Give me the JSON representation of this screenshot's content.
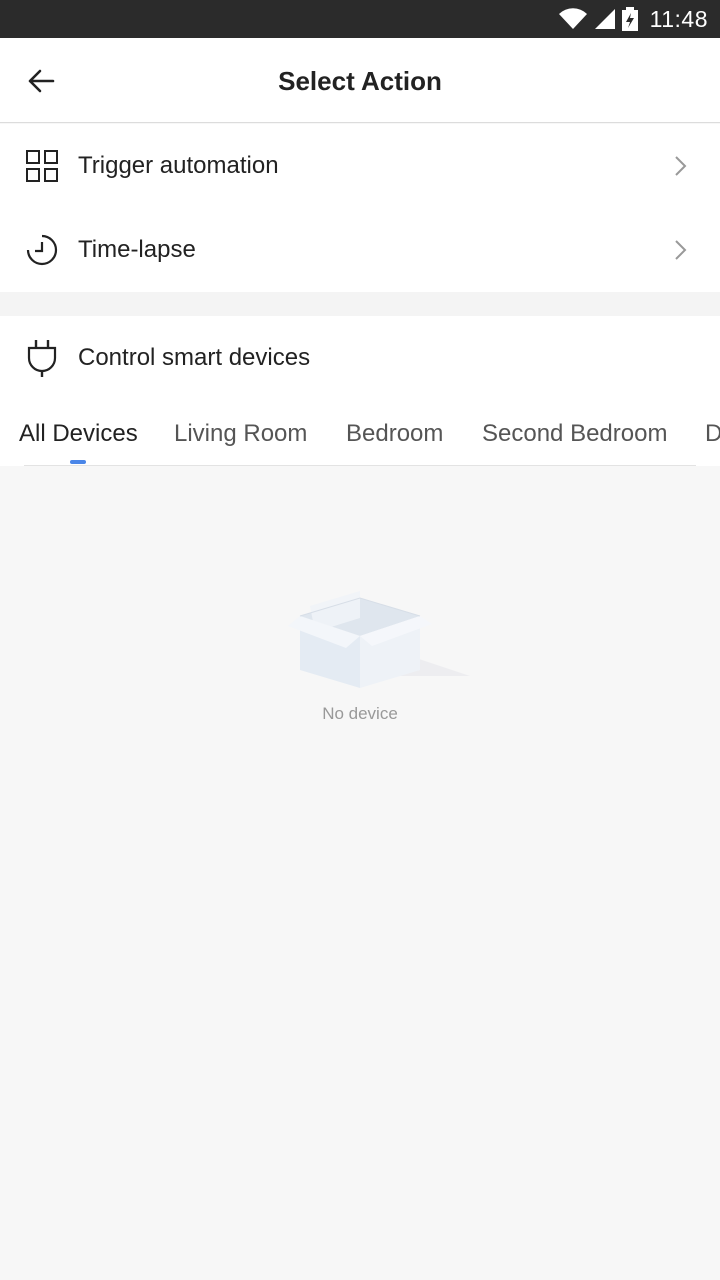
{
  "status_bar": {
    "time": "11:48"
  },
  "header": {
    "title": "Select Action"
  },
  "menu": {
    "items": [
      {
        "label": "Trigger automation",
        "icon": "grid-icon"
      },
      {
        "label": "Time-lapse",
        "icon": "clock-icon"
      }
    ]
  },
  "devices": {
    "header_label": "Control smart devices",
    "tabs": [
      "All Devices",
      "Living Room",
      "Bedroom",
      "Second Bedroom",
      "D"
    ],
    "active_tab": "All Devices",
    "empty_text": "No device"
  },
  "colors": {
    "accent": "#4a86e8",
    "status_bar": "#2b2b2b",
    "background": "#f7f7f7"
  }
}
